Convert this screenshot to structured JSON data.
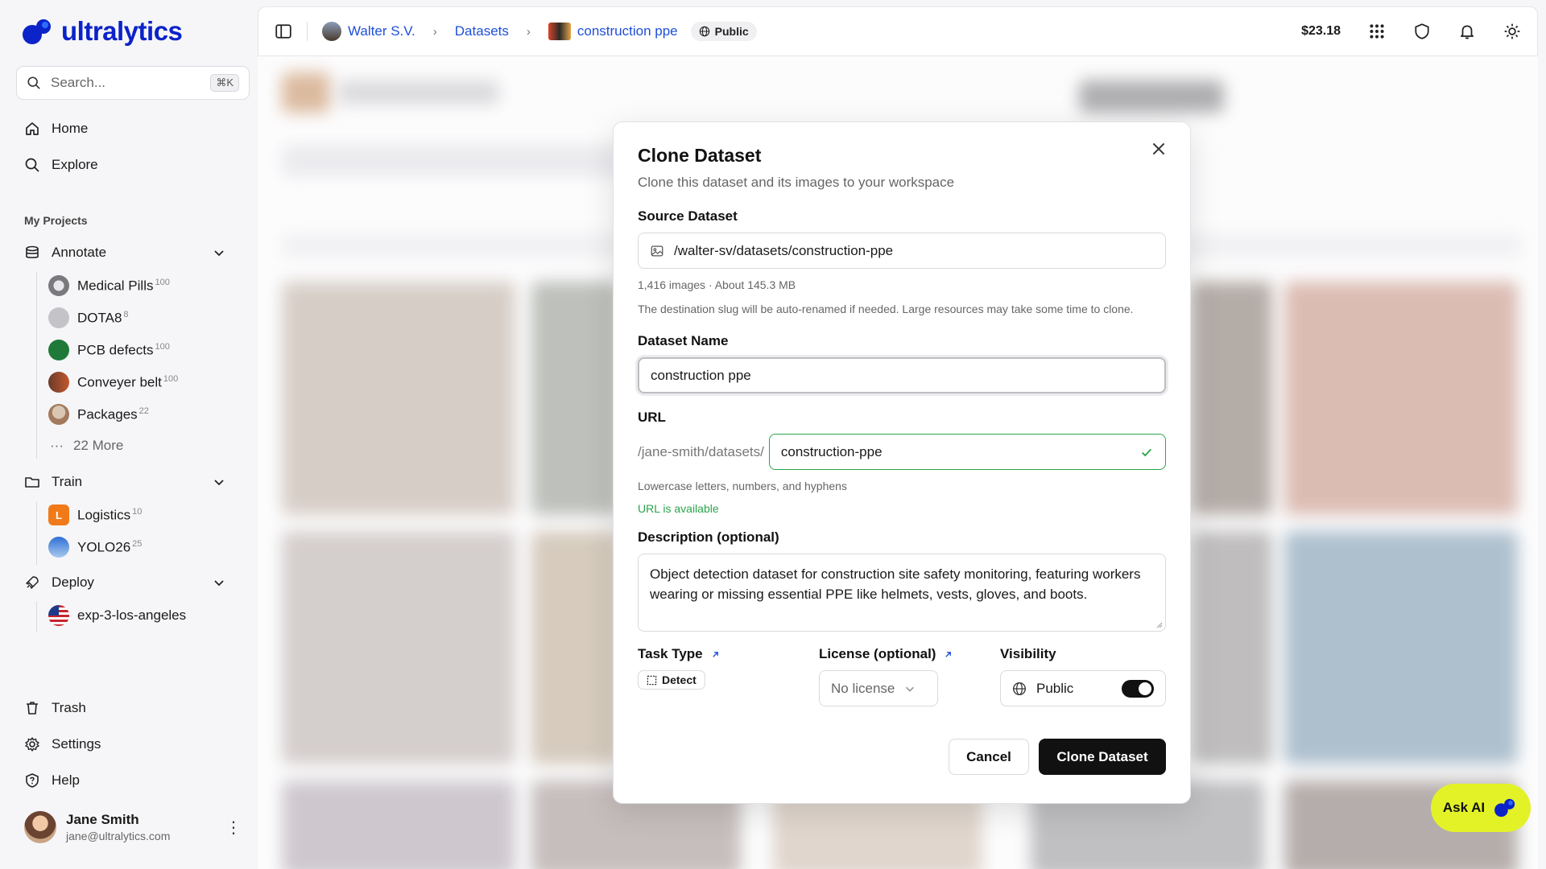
{
  "brand": {
    "name": "ultralytics"
  },
  "search": {
    "placeholder": "Search...",
    "shortcut": "⌘K"
  },
  "nav": {
    "home": "Home",
    "explore": "Explore",
    "trash": "Trash",
    "settings": "Settings",
    "help": "Help"
  },
  "projects": {
    "section_label": "My Projects",
    "annotate": {
      "label": "Annotate",
      "items": [
        {
          "name": "Medical Pills",
          "count": "100"
        },
        {
          "name": "DOTA8",
          "count": "8"
        },
        {
          "name": "PCB defects",
          "count": "100"
        },
        {
          "name": "Conveyer belt",
          "count": "100"
        },
        {
          "name": "Packages",
          "count": "22"
        }
      ],
      "more": "22 More"
    },
    "train": {
      "label": "Train",
      "items": [
        {
          "name": "Logistics",
          "count": "10",
          "badge": "L"
        },
        {
          "name": "YOLO26",
          "count": "25"
        }
      ]
    },
    "deploy": {
      "label": "Deploy",
      "items": [
        {
          "name": "exp-3-los-angeles"
        }
      ]
    }
  },
  "user": {
    "name": "Jane Smith",
    "email": "jane@ultralytics.com"
  },
  "topbar": {
    "breadcrumb": {
      "owner": "Walter S.V.",
      "section": "Datasets",
      "dataset": "construction ppe"
    },
    "visibility_chip": "Public",
    "balance": "$23.18"
  },
  "modal": {
    "title": "Clone Dataset",
    "subtitle": "Clone this dataset and its images to your workspace",
    "source": {
      "label": "Source Dataset",
      "value": "/walter-sv/datasets/construction-ppe",
      "meta": "1,416 images · About 145.3 MB",
      "note": "The destination slug will be auto-renamed if needed. Large resources may take some time to clone."
    },
    "name": {
      "label": "Dataset Name",
      "value": "construction ppe"
    },
    "url": {
      "label": "URL",
      "prefix": "/jane-smith/datasets/",
      "value": "construction-ppe",
      "hint": "Lowercase letters, numbers, and hyphens",
      "status": "URL is available"
    },
    "description": {
      "label": "Description (optional)",
      "value": "Object detection dataset for construction site safety monitoring, featuring workers wearing or missing essential PPE like helmets, vests, gloves, and boots."
    },
    "task": {
      "label": "Task Type",
      "value": "Detect"
    },
    "license": {
      "label": "License (optional)",
      "value": "No license"
    },
    "visibility": {
      "label": "Visibility",
      "value": "Public",
      "enabled": true
    },
    "cancel": "Cancel",
    "submit": "Clone Dataset"
  },
  "ask_ai": "Ask AI",
  "colors": {
    "brand": "#0b23c9",
    "success": "#2aa54a",
    "ask_ai_bg": "#e3f227",
    "link": "#1f4fd8"
  }
}
